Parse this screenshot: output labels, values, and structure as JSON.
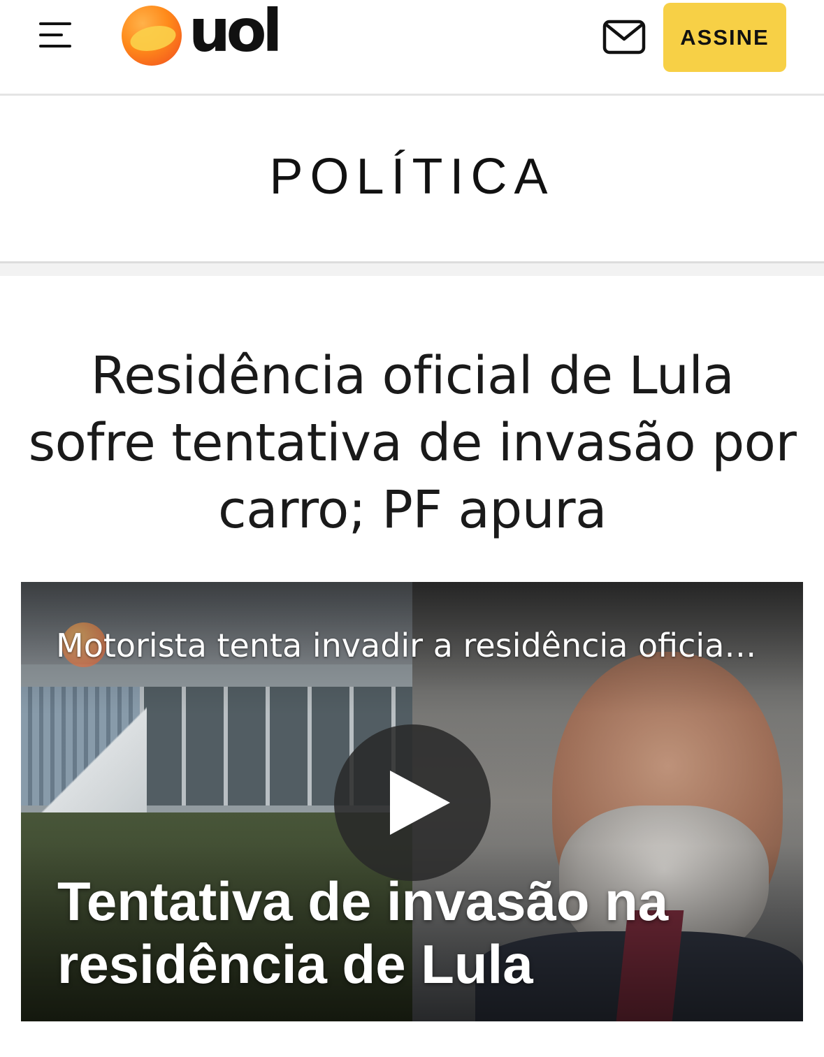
{
  "header": {
    "logo_text": "uol",
    "menu_icon": "hamburger-icon",
    "mail_icon": "mail-icon",
    "subscribe_label": "ASSINE",
    "subscribe_color": "#f7d046"
  },
  "section": {
    "title": "POLÍTICA"
  },
  "article": {
    "headline": "Residência oficial de Lula sofre tentativa de invasão por carro; PF apura"
  },
  "video": {
    "title": "Motorista tenta invadir a residência oficia…",
    "caption": "Tentativa de invasão na residência de Lula",
    "play_icon": "play-icon"
  }
}
